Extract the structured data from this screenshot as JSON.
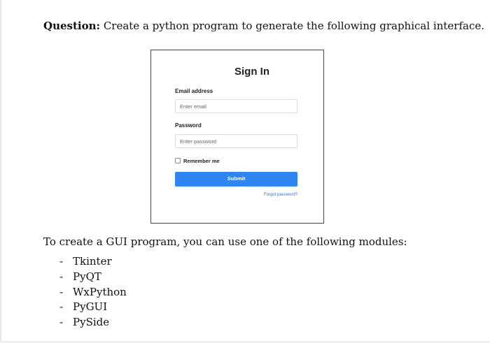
{
  "question": {
    "label": "Question:",
    "text": " Create a python program to generate the following graphical interface."
  },
  "signin": {
    "title": "Sign In",
    "email_label": "Email address",
    "email_placeholder": "Enter email",
    "password_label": "Password",
    "password_placeholder": "Enter password",
    "remember_label": "Remember me",
    "submit_label": "Submit",
    "forgot_link": "Forgot password?",
    "button_color": "#2f86f3"
  },
  "modules": {
    "intro": "To create a GUI program, you can use one of the following modules:",
    "bullet": "-",
    "items": [
      "Tkinter",
      "PyQT",
      "WxPython",
      "PyGUI",
      "PySide"
    ]
  }
}
